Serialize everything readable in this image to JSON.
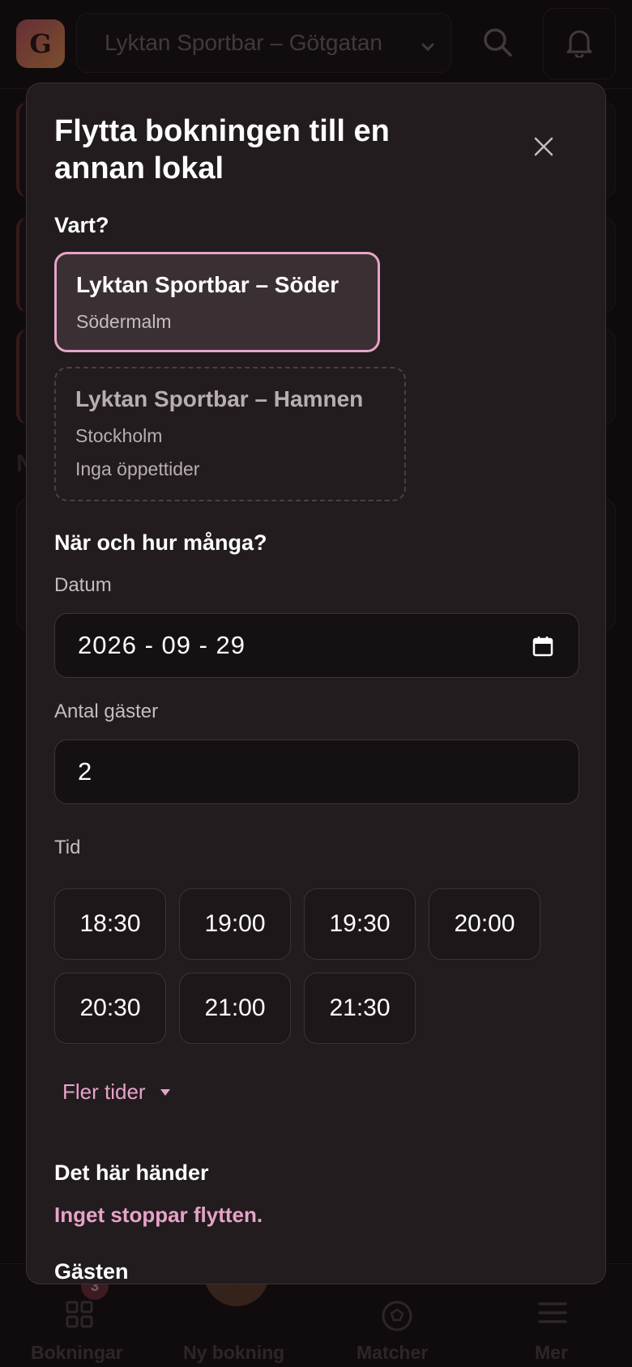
{
  "header": {
    "logo_letter": "G",
    "venue_selected": "Lyktan Sportbar – Götgatan"
  },
  "modal": {
    "title": "Flytta bokningen till en annan lokal",
    "where_heading": "Vart?",
    "venues": [
      {
        "name": "Lyktan Sportbar – Söder",
        "area": "Södermalm",
        "note": "",
        "selected": true
      },
      {
        "name": "Lyktan Sportbar – Hamnen",
        "area": "Stockholm",
        "note": "Inga öppettider",
        "selected": false
      }
    ],
    "when_heading": "När och hur många?",
    "date_label": "Datum",
    "date_value": "2026 - 09 - 29",
    "guests_label": "Antal gäster",
    "guests_value": "2",
    "time_label": "Tid",
    "time_slots": [
      "18:30",
      "19:00",
      "19:30",
      "20:00",
      "20:30",
      "21:00",
      "21:30"
    ],
    "more_times_label": "Fler tider",
    "what_happens_heading": "Det här händer",
    "what_happens_text": "Inget stoppar flytten.",
    "guest_heading": "Gästen"
  },
  "bottom_nav": {
    "items": [
      {
        "label": "Bokningar",
        "badge": "3"
      },
      {
        "label": "Ny bokning"
      },
      {
        "label": "Matcher"
      },
      {
        "label": "Mer"
      }
    ]
  },
  "colors": {
    "accent_pink": "#e7a3c8",
    "modal_bg": "#221c1f",
    "page_bg": "#140f12"
  }
}
